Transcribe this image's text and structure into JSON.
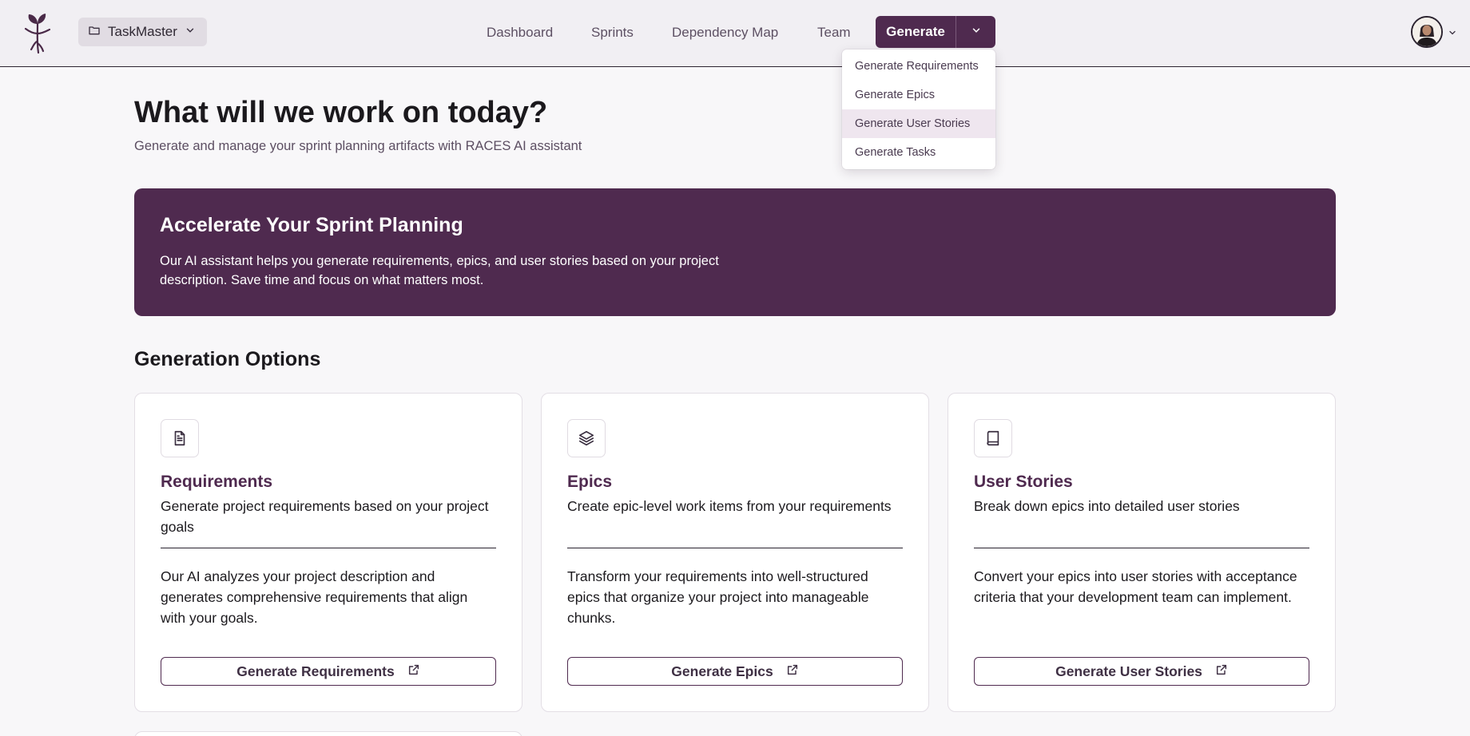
{
  "header": {
    "project_label": "TaskMaster",
    "nav": [
      "Dashboard",
      "Sprints",
      "Dependency Map",
      "Team"
    ],
    "generate_label": "Generate",
    "dropdown": [
      {
        "label": "Generate Requirements",
        "active": false
      },
      {
        "label": "Generate Epics",
        "active": false
      },
      {
        "label": "Generate User Stories",
        "active": true
      },
      {
        "label": "Generate Tasks",
        "active": false
      }
    ]
  },
  "hero": {
    "title": "What will we work on today?",
    "subtitle": "Generate and manage your sprint planning artifacts with RACES AI assistant"
  },
  "banner": {
    "title": "Accelerate Your Sprint Planning",
    "text": "Our AI assistant helps you generate requirements, epics, and user stories based on your project description. Save time and focus on what matters most."
  },
  "section_title": "Generation Options",
  "cards": [
    {
      "icon": "document-icon",
      "title": "Requirements",
      "description": "Generate project requirements based on your project goals",
      "body": "Our AI analyzes your project description and generates comprehensive requirements that align with your goals.",
      "button": "Generate Requirements"
    },
    {
      "icon": "layers-icon",
      "title": "Epics",
      "description": "Create epic-level work items from your requirements",
      "body": "Transform your requirements into well-structured epics that organize your project into manageable chunks.",
      "button": "Generate Epics"
    },
    {
      "icon": "book-icon",
      "title": "User Stories",
      "description": "Break down epics into detailed user stories",
      "body": "Convert your epics into user stories with acceptance criteria that your development team can implement.",
      "button": "Generate User Stories"
    }
  ],
  "colors": {
    "brand": "#4f2a4f",
    "background": "#f8f7f9",
    "topbar": "#f1eff3",
    "dropdown_active": "#efe6ef"
  }
}
